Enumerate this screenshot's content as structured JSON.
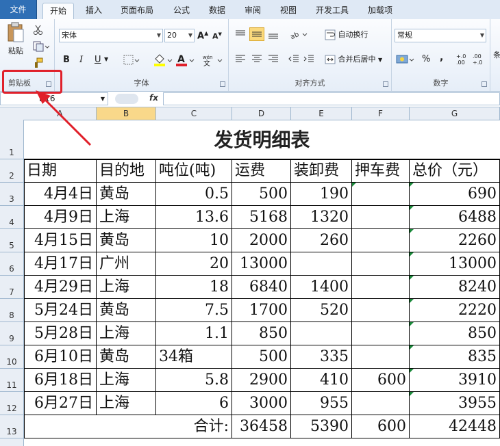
{
  "ribbon": {
    "tabs": [
      "文件",
      "开始",
      "插入",
      "页面布局",
      "公式",
      "数据",
      "审阅",
      "视图",
      "开发工具",
      "加载项"
    ],
    "clipboard": {
      "paste_label": "粘贴",
      "group_label": "剪贴板"
    },
    "font": {
      "font_name": "宋体",
      "font_size": "20",
      "bold": "B",
      "italic": "I",
      "underline": "U",
      "group_label": "字体"
    },
    "alignment": {
      "wrap_text": "自动换行",
      "merge_center": "合并后居中",
      "group_label": "对齐方式"
    },
    "number": {
      "format": "常规",
      "percent": "%",
      "comma": ",",
      "group_label": "数字",
      "inc_decimal": "+.0 .00",
      "dec_decimal": ".00 +.0"
    },
    "extra_label": "条"
  },
  "formula_bar": {
    "cell_ref": "B16",
    "fx": "fx",
    "value": ""
  },
  "columns": [
    "A",
    "B",
    "C",
    "D",
    "E",
    "F",
    "G"
  ],
  "selected_column": "B",
  "rows": [
    "1",
    "2",
    "3",
    "4",
    "5",
    "6",
    "7",
    "8",
    "9",
    "10",
    "11",
    "12",
    "13"
  ],
  "sheet": {
    "title": "发货明细表",
    "headers": [
      "日期",
      "目的地",
      "吨位(吨)",
      "运费",
      "装卸费",
      "押车费",
      "总价（元）"
    ],
    "data": [
      [
        "4月4日",
        "黄岛",
        "0.5",
        "500",
        "190",
        "",
        "690"
      ],
      [
        "4月9日",
        "上海",
        "13.6",
        "5168",
        "1320",
        "",
        "6488"
      ],
      [
        "4月15日",
        "黄岛",
        "10",
        "2000",
        "260",
        "",
        "2260"
      ],
      [
        "4月17日",
        "广州",
        "20",
        "13000",
        "",
        "",
        "13000"
      ],
      [
        "4月29日",
        "上海",
        "18",
        "6840",
        "1400",
        "",
        "8240"
      ],
      [
        "5月24日",
        "黄岛",
        "7.5",
        "1700",
        "520",
        "",
        "2220"
      ],
      [
        "5月28日",
        "上海",
        "1.1",
        "850",
        "",
        "",
        "850"
      ],
      [
        "6月10日",
        "黄岛",
        "34箱",
        "500",
        "335",
        "",
        "835"
      ],
      [
        "6月18日",
        "上海",
        "5.8",
        "2900",
        "410",
        "600",
        "3910"
      ],
      [
        "6月27日",
        "上海",
        "6",
        "3000",
        "955",
        "",
        "3955"
      ]
    ],
    "total": {
      "label": "合计:",
      "freight": "36458",
      "handling": "5390",
      "escort": "600",
      "total": "42448"
    }
  },
  "colors": {
    "file_tab": "#2f6fb5",
    "highlight": "#e0202a",
    "selected_col": "#f9d88a"
  }
}
